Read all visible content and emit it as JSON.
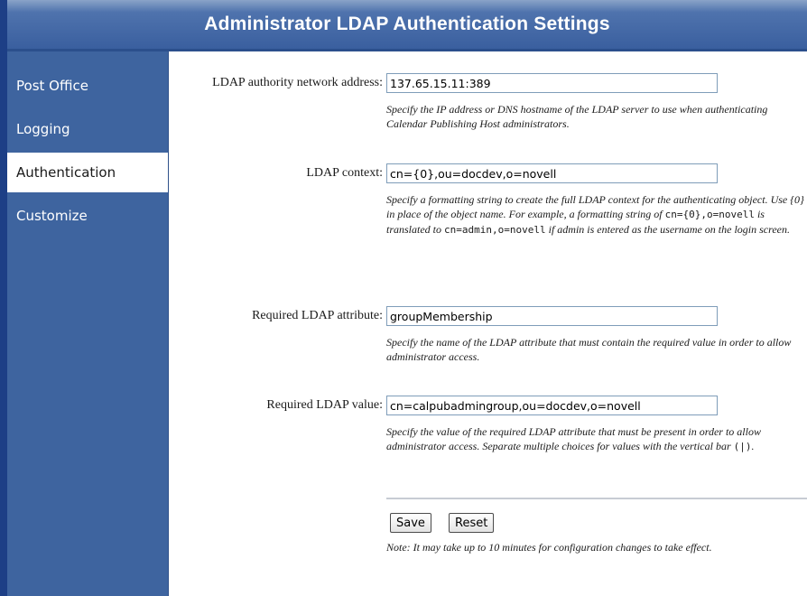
{
  "header": {
    "title": "Administrator LDAP Authentication Settings"
  },
  "sidebar": {
    "items": [
      {
        "label": "Post Office",
        "active": false
      },
      {
        "label": "Logging",
        "active": false
      },
      {
        "label": "Authentication",
        "active": true
      },
      {
        "label": "Customize",
        "active": false
      }
    ]
  },
  "form": {
    "address": {
      "label": "LDAP authority network address:",
      "value": "137.65.15.11:389",
      "help": "Specify the IP address or DNS hostname of the LDAP server to use when authenticating Calendar Publishing Host administrators."
    },
    "context": {
      "label": "LDAP context:",
      "value": "cn={0},ou=docdev,o=novell",
      "help": {
        "part1": "Specify a formatting string to create the full LDAP context for the authenticating object. Use {0} in place of the object name. For example, a formatting string of ",
        "code1": "cn={0},o=novell",
        "part2": " is translated to ",
        "code2": "cn=admin,o=novell",
        "part3": " if admin is entered as the username on the login screen."
      }
    },
    "attribute": {
      "label": "Required LDAP attribute:",
      "value": "groupMembership",
      "help": "Specify the name of the LDAP attribute that must contain the required value in order to allow administrator access."
    },
    "required_value": {
      "label": "Required LDAP value:",
      "value": "cn=calpubadmingroup,ou=docdev,o=novell",
      "help": {
        "part1": "Specify the value of the required LDAP attribute that must be present in order to allow administrator access. Separate multiple choices for values with the vertical bar ",
        "code": "(|)",
        "part2": "."
      }
    }
  },
  "actions": {
    "save_label": "Save",
    "reset_label": "Reset"
  },
  "note": "Note: It may take up to 10 minutes for configuration changes to take effect.",
  "colors": {
    "header": "#3a5f9f",
    "sidebar": "#3e649f",
    "left_edge": "#1d3f86"
  }
}
